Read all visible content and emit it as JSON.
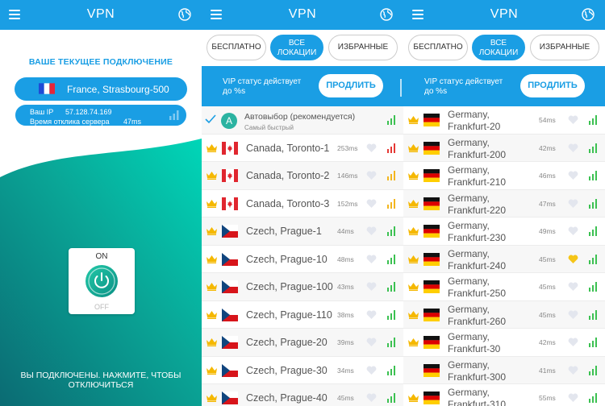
{
  "app_title": "VPN",
  "current": {
    "heading": "ВАШЕ ТЕКУЩЕЕ ПОДКЛЮЧЕНИЕ",
    "location": "France, Strasbourg-500",
    "ip_label": "Ваш IP",
    "ip_value": "57.128.74.169",
    "ping_label": "Время отклика сервера",
    "ping_value": "47ms",
    "power_on": "ON",
    "power_off": "OFF",
    "status": "ВЫ ПОДКЛЮЧЕНЫ. НАЖМИТЕ, ЧТОБЫ ОТКЛЮЧИТЬСЯ"
  },
  "tabs": [
    {
      "label": "БЕСПЛАТНО"
    },
    {
      "line1": "ВСЕ",
      "line2": "ЛОКАЦИИ"
    },
    {
      "label": "ИЗБРАННЫЕ"
    }
  ],
  "vip": {
    "line1": "VIP статус действует",
    "line2": "до %s",
    "button": "ПРОДЛИТЬ"
  },
  "auto": {
    "title": "Автовыбор (рекомендуется)",
    "subtitle": "Самый быстрый",
    "letter": "A"
  },
  "list_all": [
    {
      "name": "Canada, Toronto-1",
      "ms": "253ms",
      "flag": "ca",
      "signal": "red"
    },
    {
      "name": "Canada, Toronto-2",
      "ms": "146ms",
      "flag": "ca",
      "signal": "yellow"
    },
    {
      "name": "Canada, Toronto-3",
      "ms": "152ms",
      "flag": "ca",
      "signal": "yellow"
    },
    {
      "name": "Czech, Prague-1",
      "ms": "44ms",
      "flag": "cz",
      "signal": "green"
    },
    {
      "name": "Czech, Prague-10",
      "ms": "48ms",
      "flag": "cz",
      "signal": "green"
    },
    {
      "name": "Czech, Prague-100",
      "ms": "43ms",
      "flag": "cz",
      "signal": "green"
    },
    {
      "name": "Czech, Prague-110",
      "ms": "38ms",
      "flag": "cz",
      "signal": "green"
    },
    {
      "name": "Czech, Prague-20",
      "ms": "39ms",
      "flag": "cz",
      "signal": "green"
    },
    {
      "name": "Czech, Prague-30",
      "ms": "34ms",
      "flag": "cz",
      "signal": "green"
    },
    {
      "name": "Czech, Prague-40",
      "ms": "45ms",
      "flag": "cz",
      "signal": "green"
    }
  ],
  "list_de": [
    {
      "l1": "Germany,",
      "l2": "Frankfurt-20",
      "ms": "54ms",
      "fav": false,
      "crown": true
    },
    {
      "l1": "Germany,",
      "l2": "Frankfurt-200",
      "ms": "42ms",
      "fav": false,
      "crown": true
    },
    {
      "l1": "Germany,",
      "l2": "Frankfurt-210",
      "ms": "46ms",
      "fav": false,
      "crown": true
    },
    {
      "l1": "Germany,",
      "l2": "Frankfurt-220",
      "ms": "47ms",
      "fav": false,
      "crown": true
    },
    {
      "l1": "Germany,",
      "l2": "Frankfurt-230",
      "ms": "49ms",
      "fav": false,
      "crown": true
    },
    {
      "l1": "Germany,",
      "l2": "Frankfurt-240",
      "ms": "45ms",
      "fav": true,
      "crown": true
    },
    {
      "l1": "Germany,",
      "l2": "Frankfurt-250",
      "ms": "45ms",
      "fav": false,
      "crown": true
    },
    {
      "l1": "Germany,",
      "l2": "Frankfurt-260",
      "ms": "45ms",
      "fav": false,
      "crown": true
    },
    {
      "l1": "Germany,",
      "l2": "Frankfurt-30",
      "ms": "42ms",
      "fav": false,
      "crown": true
    },
    {
      "l1": "Germany,",
      "l2": "Frankfurt-300",
      "ms": "41ms",
      "fav": false,
      "crown": false
    },
    {
      "l1": "Germany,",
      "l2": "Frankfurt-310",
      "ms": "55ms",
      "fav": false,
      "crown": true
    }
  ],
  "colors": {
    "primary": "#1a9ee4",
    "teal": "#00c7b0",
    "teal_dark": "#0b6b73",
    "crown": "#f5b800",
    "signal_green": "#3cc152",
    "signal_yellow": "#f3b61f",
    "signal_red": "#e53935",
    "heart_off": "#e3e6ee",
    "heart_on": "#f5c518"
  },
  "icons": {
    "menu": "hamburger-icon",
    "globe": "globe-icon",
    "crown": "crown-icon",
    "heart": "heart-icon",
    "signal": "signal-bars-icon",
    "check": "check-icon",
    "power": "power-icon"
  }
}
